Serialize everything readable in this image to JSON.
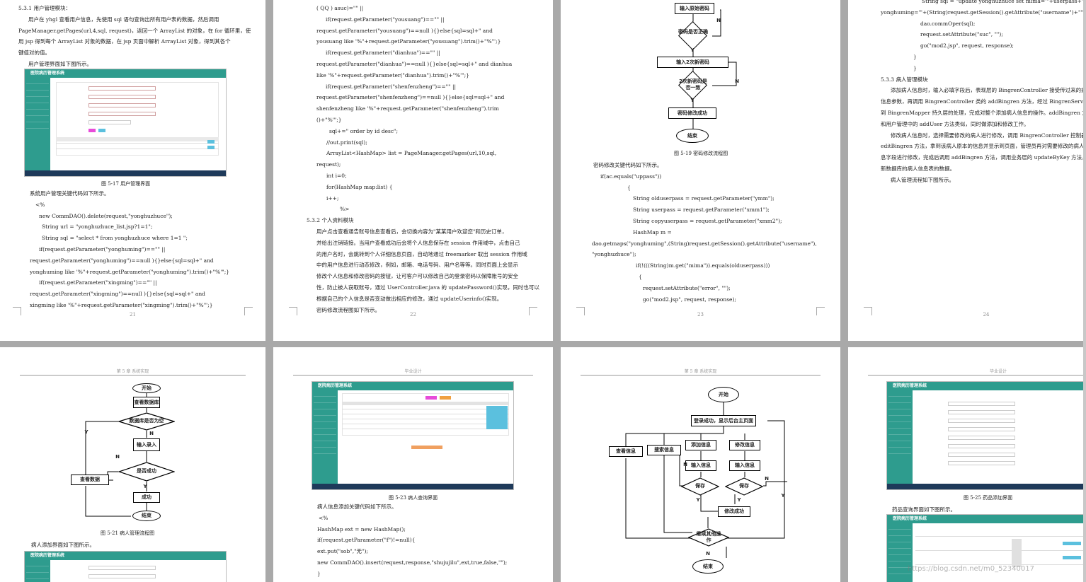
{
  "pages": {
    "p21": {
      "number": "21",
      "lines": [
        "5.3.1 用户管理模块：",
        "用户在 yhgl 查看用户信息，先使用 sql 语句查询出所有用户表的数据，然后调用",
        "PageManager.getPages(url,4,sql, request)，返回一个 ArrayList 的对象，在 for 循环里，使",
        "用 jsp 得到每个 ArrayList 对象的数据，在 jsp 页面中解析 ArrayList 对象，得到其各个",
        "键值对的值。",
        "用户管理界面如下图所示。"
      ],
      "caption": "图 5-17 用户管理界面",
      "lines2": [
        "系统用户管理关键代码如下所示。",
        "<%",
        "new CommDAO().delete(request,\"yonghuzhuce\");",
        "String url = \"yonghuzhuce_list.jsp?1=1\";",
        "String sql = \"select * from yonghuzhuce where 1=1 \";",
        "if(request.getParameter(\"yonghuming\")==\"\" ||",
        "request.getParameter(\"yonghuming\")==null ){}else{sql=sql+\" and",
        "yonghuming like '%\"+request.getParameter(\"yonghuming\").trim()+\"%'\";}",
        "if(request.getParameter(\"xingming\")==\"\" ||",
        "request.getParameter(\"xingming\")==null ){}else{sql=sql+\" and",
        "xingming like '%\"+request.getParameter(\"xingming\").trim()+\"%'\";}"
      ]
    },
    "p22": {
      "number": "22",
      "lines": [
        "( QQ ) asuc)=\"\" ||",
        "if(request.getParameter(\"yousuang\")==\"\" ||",
        "request.getParameter(\"yousuang\")==null ){}else{sql=sql+\" and",
        "yousuang like '%\"+request.getParameter(\"yousuang\").trim()+\"%'\";}",
        "if(request.getParameter(\"dianhua\")==\"\" ||",
        "request.getParameter(\"dianhua\")==null ){}else{sql=sql+\" and dianhua",
        "like '%\"+request.getParameter(\"dianhua\").trim()+\"%'\";}",
        "if(request.getParameter(\"shenfenzheng\")==\"\" ||",
        "request.getParameter(\"shenfenzheng\")==null ){}else{sql=sql+\" and",
        "shenfenzheng like '%\"+request.getParameter(\"shenfenzheng\").trim",
        "()+\"%'\";}",
        "sql+=\" order by id desc\";",
        "//out.print(sql);",
        "ArrayList<HashMap> list = PageManager.getPages(url,10,sql,",
        "request);",
        "int i=0;",
        "for(HashMap map:list) {",
        "i++;",
        "%>",
        "5.3.2 个人资料模块",
        "用户点击查看通告账号信息查看后，会切换内容为\"某某用户欢迎您\"和历史订单，",
        "并给出注销链接。当用户查看成功后会将个人信息保存在 session 作用域中，点击自己",
        "的用户名时，会跳转到个人详细信息页面，自动地通过 freemarker 取出 session 作用域",
        "中的用户信息进行动态修改，例如，邮箱、电话号码、用户名等等。同时页面上会显示",
        "修改个人信息和修改密码的按钮，让可客户可以修改自己的登录密码以保障账号的安全",
        "性，防止被人窃取账号，通过 UserController.java 的 updatePassword()实现，同时也可以",
        "根据自己的个人信息是否变动做出相应的修改，通过 updateUserinfo()实现。",
        "密码修改流程图如下所示。"
      ]
    },
    "p23": {
      "number": "23",
      "flow": {
        "n1": "输入原始密码",
        "d1": "密码是否正确",
        "n2": "输入2次新密码",
        "d2": "2次新密码是否一致",
        "n3": "密码修改成功",
        "end": "结束",
        "yes": "Y",
        "no": "N"
      },
      "caption": "图 5-19 密码修改流程图",
      "lines": [
        "密码修改关键代码如下所示。",
        "if(ac.equals(\"uppass\"))",
        "{",
        "String olduserpass = request.getParameter(\"ymm\");",
        "String userpass = request.getParameter(\"xmm1\");",
        "String copyuserpass = request.getParameter(\"xmm2\");",
        "HashMap m =",
        "dao.getmaps(\"yonghuming\",(String)request.getSession().getAttribute(\"username\"),",
        "\"yonghuzhuce\");",
        "if(!(((String)m.get(\"mima\")).equals(olduserpass)))",
        "{",
        "request.setAttribute(\"error\", \"\");",
        "go(\"mod2.jsp\", request, response);"
      ]
    },
    "p24": {
      "number": "24",
      "lines": [
        "String sql = \"update yonghuzhuce set mima='\"+userpass+\"' where",
        "yonghuming='\"+(String)request.getSession().getAttribute(\"username\")+\"'\";",
        "dao.commOper(sql);",
        "request.setAttribute(\"suc\", \"\");",
        "go(\"mod2.jsp\", request, response);",
        "}",
        "}",
        "5.3.3 病人管理模块",
        "添加病人信息时，输入必填字段后，表现层的 BingrenController 接受传过来的病人",
        "信息参数，再调用 BingrenController 类的 addBingren 方法，经过 BingrenService 业务层",
        "到 BingrenMapper 持久层的处理，完成对整个添加病人信息的操作。addBingren 方法",
        "和用户管理中的 addUser 方法类似，同时做添加和修改工作。",
        "修改病人信息时，选择需要修改的病人进行修改，调用 BingrenController 控制器",
        "editBingren 方法，拿到该病人原本的信息并显示到页面，管理员再对需要修改的病人信",
        "息字段进行修改，完成后调用 addBingren 方法，调用业务层的 updateByKey 方法，更",
        "新数据库的病人信息表的数据。",
        "病人管理流程如下图所示。"
      ]
    },
    "p25": {
      "header": "第 5 章  系统实现",
      "flow": {
        "start": "开始",
        "n1": "查看数据库",
        "d1": "数据库是否为空",
        "n2": "输入录入",
        "d2": "是否成功",
        "n3": "成功",
        "n4": "查看数据",
        "end": "结束",
        "yes": "Y",
        "no": "N"
      },
      "caption": "图 5-21 病人管理流程图",
      "lines": [
        "病人添加界面如下图所示。"
      ]
    },
    "p26": {
      "header": "毕业设计",
      "caption": "图 5-23 病人查询界面",
      "lines": [
        "病人信息添加关键代码如下所示。",
        "<%",
        "HashMap ext = new HashMap();",
        "if(request.getParameter(\"f\")!=null){",
        "ext.put(\"sob\",\"无\");",
        "new CommDAO().insert(request,response,\"shujujilu\",ext,true,false,\"\");",
        "}"
      ]
    },
    "p27": {
      "header": "第 5 章  系统实现",
      "flow": {
        "start": "开始",
        "n1": "登录成功，显示后台主页面",
        "a": "查看信息",
        "b": "搜索信息",
        "c": "添加信息",
        "d": "修改信息",
        "e": "输入信息",
        "f": "输入信息",
        "g": "保存",
        "h": "保存",
        "i": "修改成功",
        "j": "继续其他操作",
        "end": "结束",
        "yes": "Y",
        "no": "N"
      }
    },
    "p28": {
      "header": "毕业设计",
      "caption": "图 5-25 药品添加界面",
      "lines": [
        "药品查询界面如下图所示。"
      ]
    }
  },
  "screens": {
    "app_title": "医院病历管理系统"
  },
  "watermark": "https://blog.csdn.net/m0_52340017"
}
